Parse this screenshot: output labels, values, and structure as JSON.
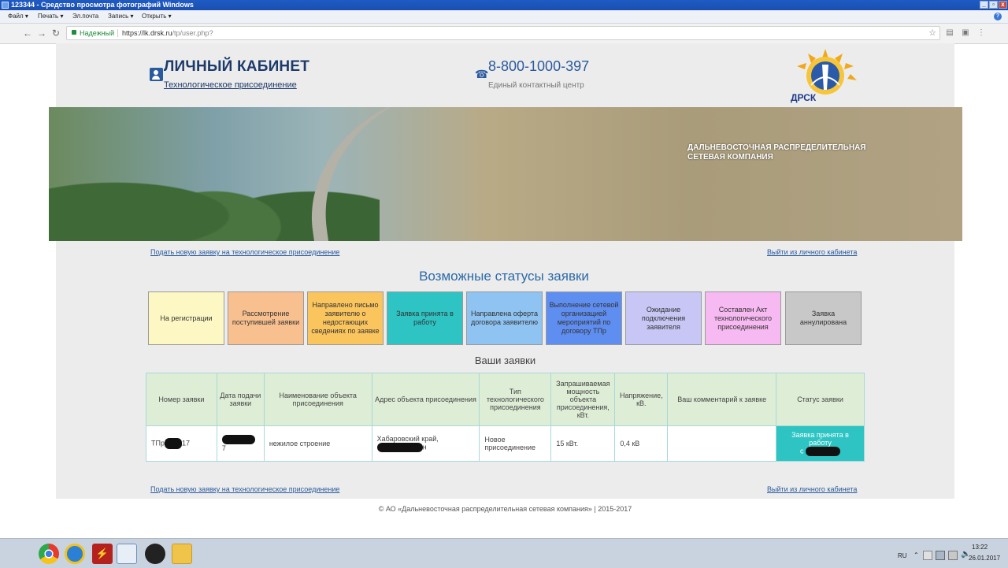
{
  "window": {
    "title": "123344 - Средство просмотра фотографий Windows"
  },
  "menu": {
    "items": [
      "Файл",
      "Печать",
      "Эл.почта",
      "Запись",
      "Открыть"
    ]
  },
  "browser": {
    "secure_label": "Надежный",
    "url_host": "https://lk.drsk.ru",
    "url_path": "/tp/user.php?"
  },
  "header": {
    "cabinet_title": "ЛИЧНЫЙ КАБИНЕТ",
    "cabinet_subtitle": "Технологическое присоединение",
    "phone": "8-800-1000-397",
    "phone_caption": "Единый контактный центр",
    "logo_text": "ДРСК"
  },
  "banner": {
    "company": "ДАЛЬНЕВОСТОЧНАЯ РАСПРЕДЕЛИТЕЛЬНАЯ СЕТЕВАЯ КОМПАНИЯ"
  },
  "links": {
    "new_request": "Подать новую заявку на технологическое присоединение",
    "logout": "Выйти из личного кабинета"
  },
  "statuses": {
    "title": "Возможные статусы заявки",
    "items": [
      {
        "label": "На регистрации",
        "color": "#fdf8c3"
      },
      {
        "label": "Рассмотрение поступившей заявки",
        "color": "#f9c08f"
      },
      {
        "label": "Направлено письмо заявителю о недостающих сведениях по заявке",
        "color": "#fbc55e"
      },
      {
        "label": "Заявка принята в работу",
        "color": "#2ec4c4"
      },
      {
        "label": "Направлена оферта договора заявителю",
        "color": "#8fc3f2"
      },
      {
        "label": "Выполнение сетевой организацией мероприятий по договору ТПр",
        "color": "#5f8ef1"
      },
      {
        "label": "Ожидание подключения заявителя",
        "color": "#c7c6f5"
      },
      {
        "label": "Составлен Акт технологического присоединения",
        "color": "#f7b9f1"
      },
      {
        "label": "Заявка аннулирована",
        "color": "#c8c8c8"
      }
    ]
  },
  "requests": {
    "title": "Ваши заявки",
    "headers": [
      "Номер заявки",
      "Дата подачи заявки",
      "Наименование объекта присоединения",
      "Адрес объекта присоединения",
      "Тип технологического присоединения",
      "Запрашиваемая мощность объекта присоединения, кВт.",
      "Напряжение, кВ.",
      "Ваш комментарий к заявке",
      "Статус заявки"
    ],
    "row": {
      "number_prefix": "ТПр",
      "number_suffix": "17",
      "date_suffix": "7",
      "object": "нежилое строение",
      "address": "Хабаровский край,",
      "address_suffix": "н",
      "type": "Новое присоединение",
      "power": "15 кВт.",
      "voltage": "0,4 кВ",
      "comment": "",
      "status": "Заявка принята в работу",
      "status_suffix": "с"
    }
  },
  "footer": {
    "text": "© АО «Дальневосточная распределительная сетевая компания» | 2015-2017"
  },
  "tray": {
    "lang": "RU",
    "time": "13:22",
    "date": "26.01.2017"
  }
}
